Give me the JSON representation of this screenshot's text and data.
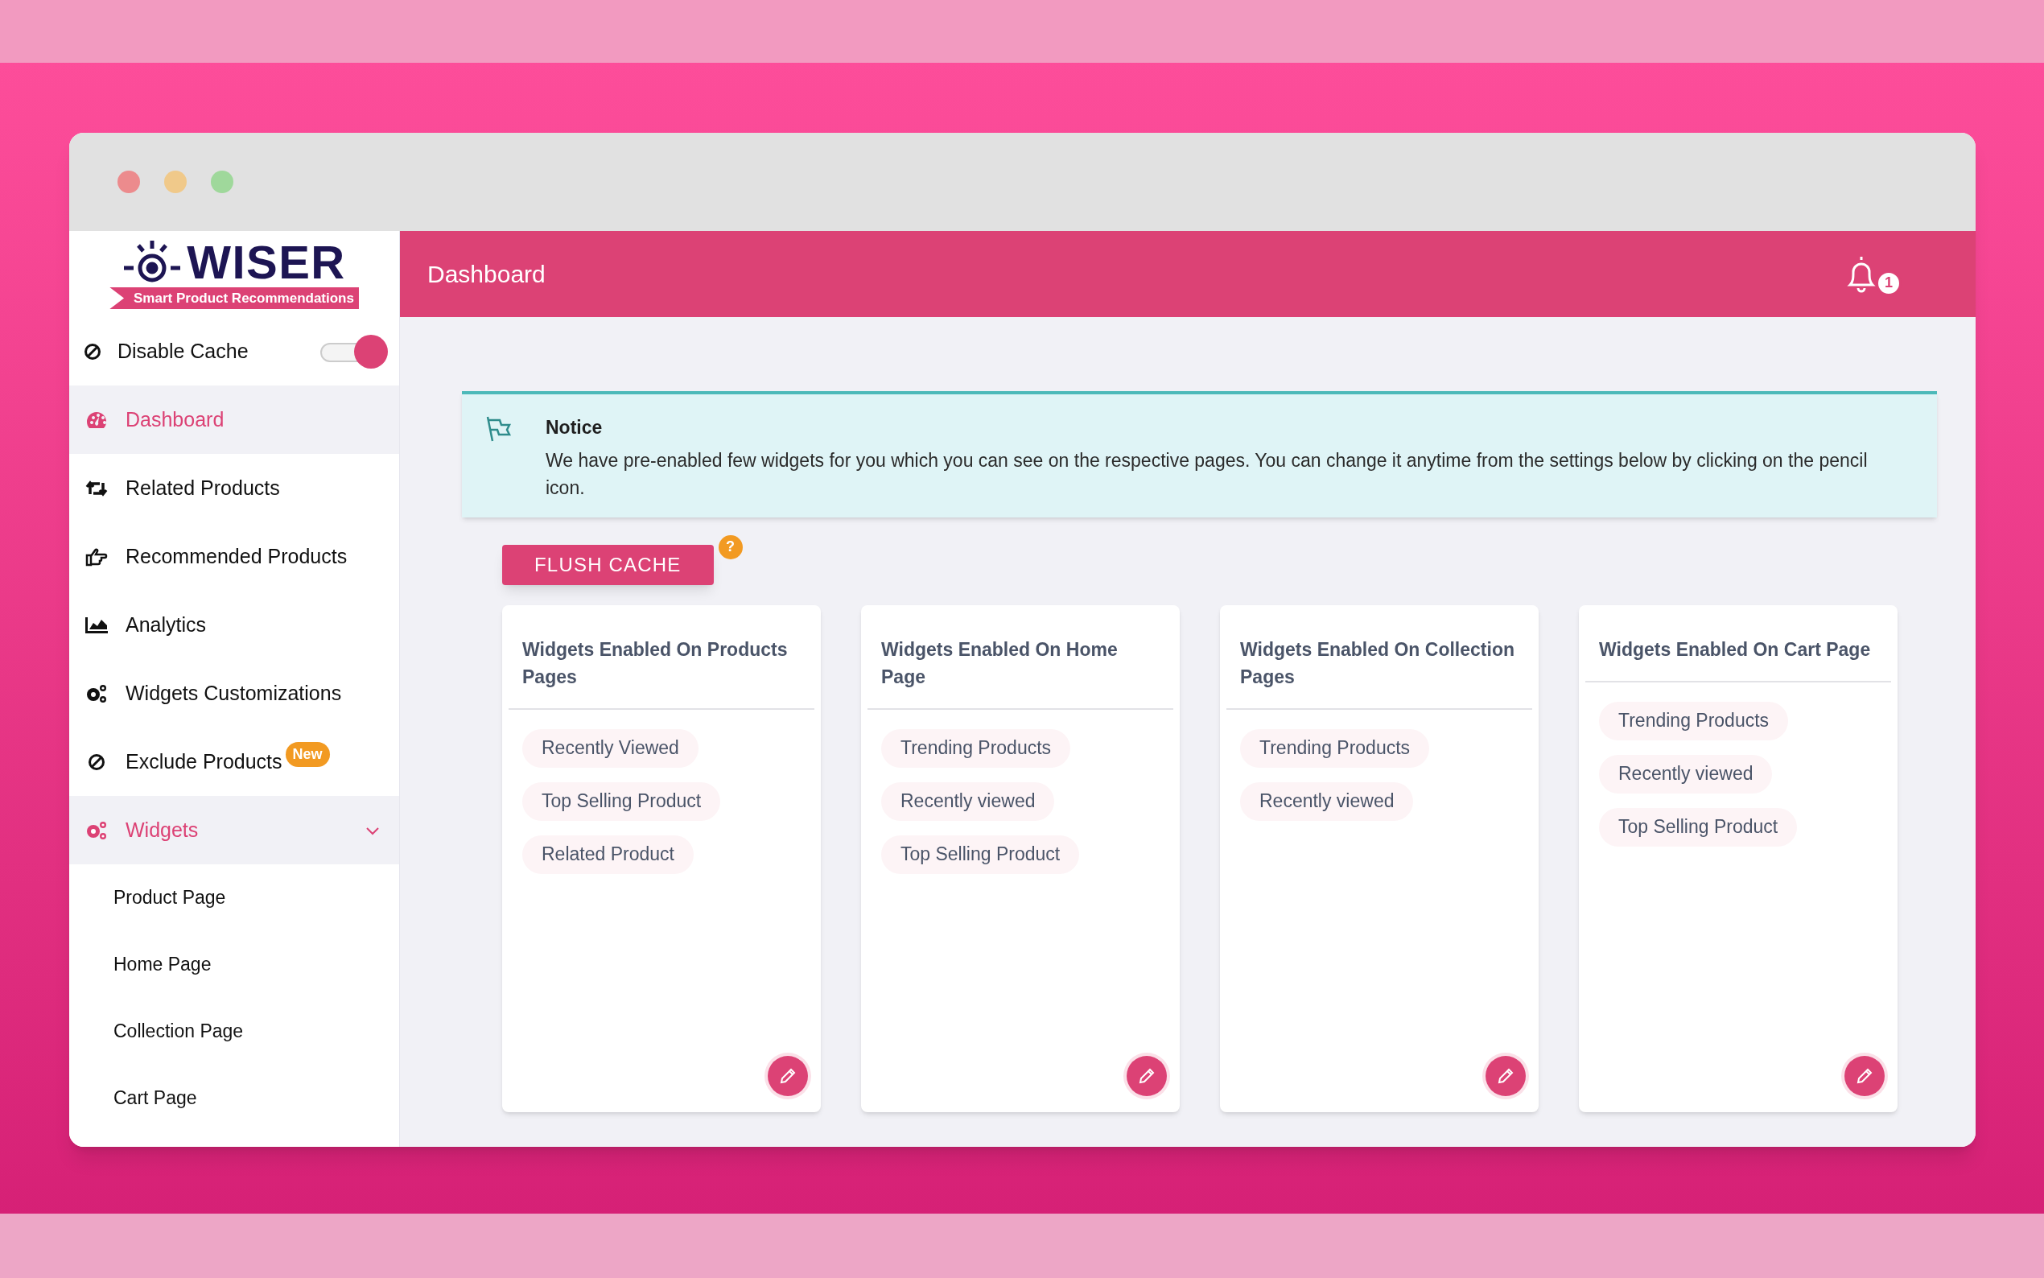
{
  "sidebar": {
    "logo": {
      "wordmark": "WISER",
      "tagline": "Smart Product Recommendations"
    },
    "disable_cache": {
      "label": "Disable Cache",
      "on": true
    },
    "items": [
      {
        "label": "Dashboard",
        "selected": true
      },
      {
        "label": "Related Products",
        "selected": false
      },
      {
        "label": "Recommended Products",
        "selected": false
      },
      {
        "label": "Analytics",
        "selected": false
      },
      {
        "label": "Widgets Customizations",
        "selected": false
      },
      {
        "label": "Exclude Products",
        "selected": false,
        "badge": "New"
      },
      {
        "label": "Widgets",
        "selected": true,
        "expanded": true,
        "children": [
          {
            "label": "Product Page",
            "selected": false
          },
          {
            "label": "Home Page",
            "selected": false
          },
          {
            "label": "Collection Page",
            "selected": false
          },
          {
            "label": "Cart Page",
            "selected": false
          }
        ]
      }
    ]
  },
  "header": {
    "title": "Dashboard",
    "notification_count": "1"
  },
  "notice": {
    "title": "Notice",
    "message": "We have pre-enabled few widgets for you which you can see on the respective pages. You can change it anytime from the settings below by clicking on the pencil icon."
  },
  "flush_cache": {
    "label": "FLUSH CACHE",
    "help": "?"
  },
  "cards": [
    {
      "title": "Widgets Enabled On Products Pages",
      "widgets": [
        "Recently Viewed",
        "Top Selling Product",
        "Related Product"
      ]
    },
    {
      "title": "Widgets Enabled On Home Page",
      "widgets": [
        "Trending Products",
        "Recently viewed",
        "Top Selling Product"
      ]
    },
    {
      "title": "Widgets Enabled On Collection Pages",
      "widgets": [
        "Trending Products",
        "Recently viewed"
      ]
    },
    {
      "title": "Widgets Enabled On Cart Page",
      "widgets": [
        "Trending Products",
        "Recently viewed",
        "Top Selling Product"
      ]
    }
  ]
}
